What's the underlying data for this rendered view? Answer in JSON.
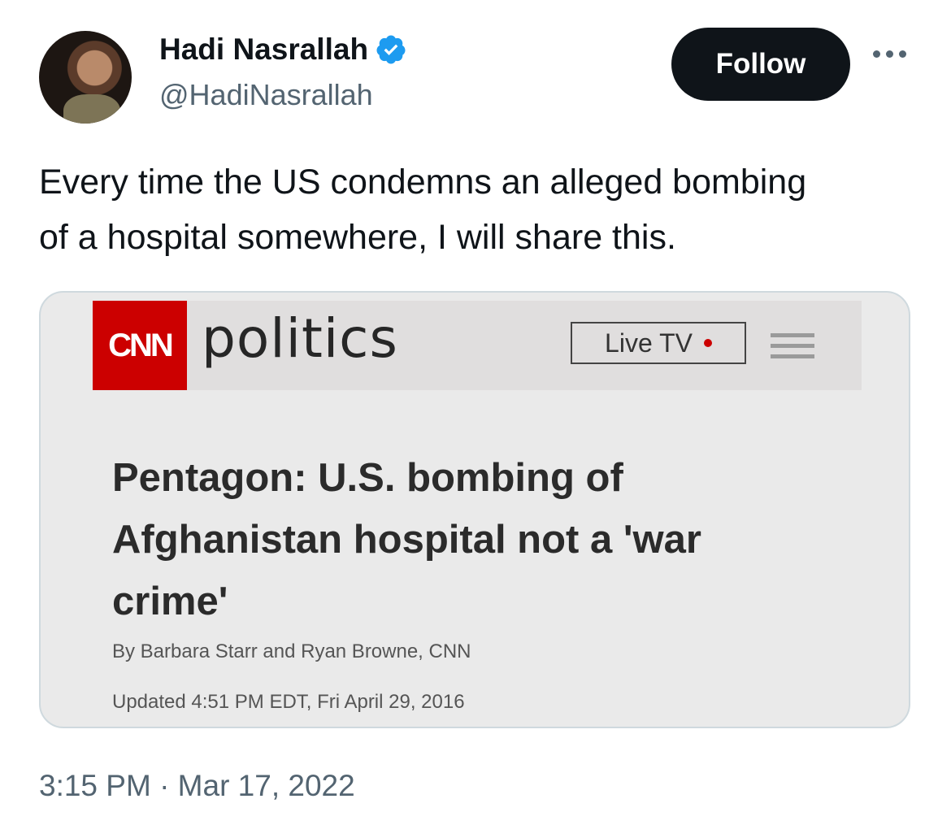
{
  "author": {
    "name": "Hadi Nasrallah",
    "handle": "@HadiNasrallah",
    "verified_color": "#1d9bf0"
  },
  "follow_label": "Follow",
  "tweet": {
    "text": "Every time the US condemns an alleged bombing\nof a hospital somewhere, I will share this.",
    "timestamp": "3:15 PM · Mar 17, 2022"
  },
  "media": {
    "logo_text": "CNN",
    "section": "politics",
    "live_tv": "Live TV",
    "headline": "Pentagon: U.S. bombing of Afghanistan hospital not a 'war crime'",
    "byline": "By Barbara Starr and Ryan Browne, CNN",
    "updated": "Updated 4:51 PM EDT, Fri April 29, 2016",
    "brand_color": "#cc0000"
  }
}
